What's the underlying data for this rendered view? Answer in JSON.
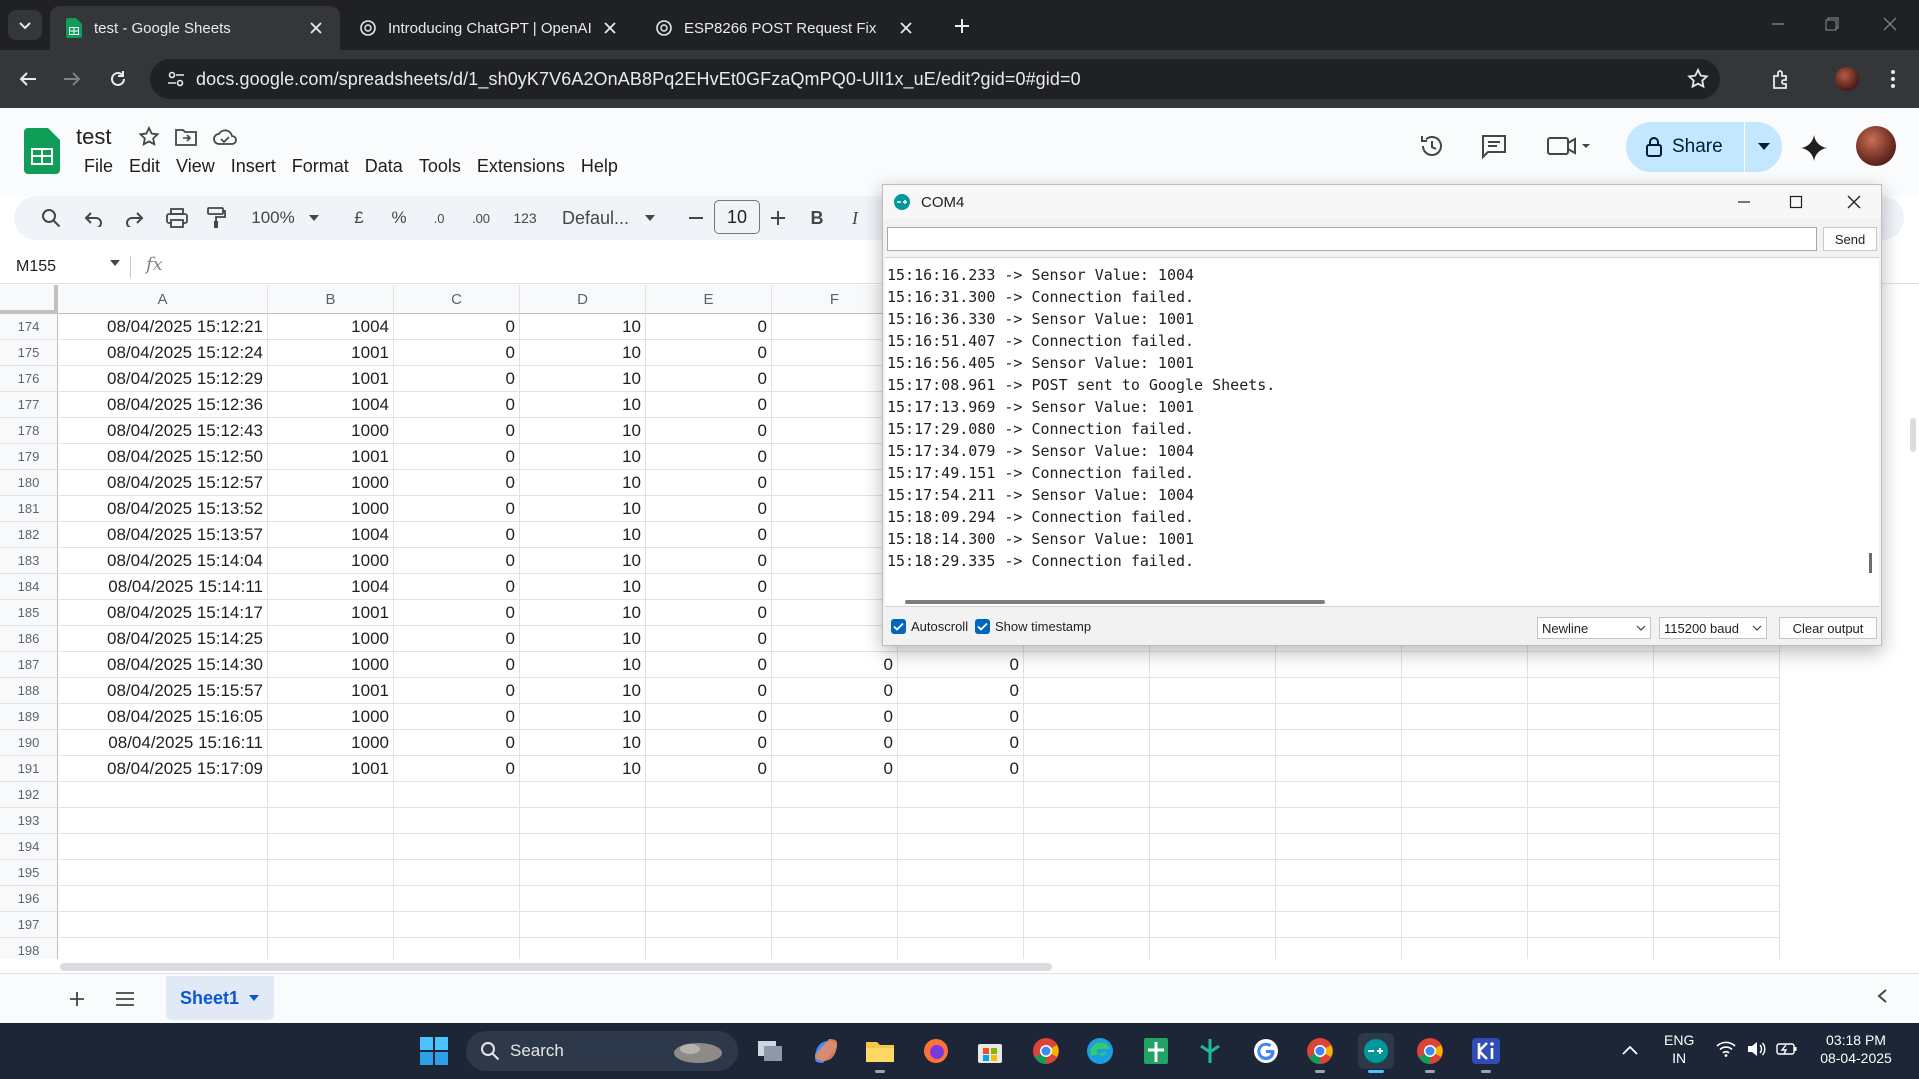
{
  "browser": {
    "tabs": [
      {
        "title": "test - Google Sheets",
        "icon": "sheets-icon"
      },
      {
        "title": "Introducing ChatGPT | OpenAI",
        "icon": "openai-icon"
      },
      {
        "title": "ESP8266 POST Request Fix",
        "icon": "openai-icon"
      }
    ],
    "url": "docs.google.com/spreadsheets/d/1_sh0yK7V6A2OnAB8Pq2EHvEt0GFzaQmPQ0-UlI1x_uE/edit?gid=0#gid=0"
  },
  "sheets": {
    "doc_title": "test",
    "menus": [
      "File",
      "Edit",
      "View",
      "Insert",
      "Format",
      "Data",
      "Tools",
      "Extensions",
      "Help"
    ],
    "share_label": "Share",
    "toolbar": {
      "zoom": "100%",
      "currency": "£",
      "percent": "%",
      "dec_decrease": ".0",
      "dec_increase": ".00",
      "format_123": "123",
      "font": "Defaul...",
      "font_size": "10",
      "bold": "B",
      "italic": "I"
    },
    "name_box": "M155",
    "fx": "fx",
    "columns": [
      "A",
      "B",
      "C",
      "D",
      "E",
      "F"
    ],
    "rows": [
      {
        "n": "174",
        "cells": [
          "08/04/2025 15:12:21",
          "1004",
          "0",
          "10",
          "0",
          "",
          ""
        ]
      },
      {
        "n": "175",
        "cells": [
          "08/04/2025 15:12:24",
          "1001",
          "0",
          "10",
          "0",
          "",
          ""
        ]
      },
      {
        "n": "176",
        "cells": [
          "08/04/2025 15:12:29",
          "1001",
          "0",
          "10",
          "0",
          "",
          ""
        ]
      },
      {
        "n": "177",
        "cells": [
          "08/04/2025 15:12:36",
          "1004",
          "0",
          "10",
          "0",
          "",
          ""
        ]
      },
      {
        "n": "178",
        "cells": [
          "08/04/2025 15:12:43",
          "1000",
          "0",
          "10",
          "0",
          "",
          ""
        ]
      },
      {
        "n": "179",
        "cells": [
          "08/04/2025 15:12:50",
          "1001",
          "0",
          "10",
          "0",
          "",
          ""
        ]
      },
      {
        "n": "180",
        "cells": [
          "08/04/2025 15:12:57",
          "1000",
          "0",
          "10",
          "0",
          "",
          ""
        ]
      },
      {
        "n": "181",
        "cells": [
          "08/04/2025 15:13:52",
          "1000",
          "0",
          "10",
          "0",
          "",
          ""
        ]
      },
      {
        "n": "182",
        "cells": [
          "08/04/2025 15:13:57",
          "1004",
          "0",
          "10",
          "0",
          "",
          ""
        ]
      },
      {
        "n": "183",
        "cells": [
          "08/04/2025 15:14:04",
          "1000",
          "0",
          "10",
          "0",
          "",
          ""
        ]
      },
      {
        "n": "184",
        "cells": [
          "08/04/2025 15:14:11",
          "1004",
          "0",
          "10",
          "0",
          "",
          ""
        ]
      },
      {
        "n": "185",
        "cells": [
          "08/04/2025 15:14:17",
          "1001",
          "0",
          "10",
          "0",
          "",
          ""
        ]
      },
      {
        "n": "186",
        "cells": [
          "08/04/2025 15:14:25",
          "1000",
          "0",
          "10",
          "0",
          "",
          ""
        ]
      },
      {
        "n": "187",
        "cells": [
          "08/04/2025 15:14:30",
          "1000",
          "0",
          "10",
          "0",
          "0",
          "0"
        ]
      },
      {
        "n": "188",
        "cells": [
          "08/04/2025 15:15:57",
          "1001",
          "0",
          "10",
          "0",
          "0",
          "0"
        ]
      },
      {
        "n": "189",
        "cells": [
          "08/04/2025 15:16:05",
          "1000",
          "0",
          "10",
          "0",
          "0",
          "0"
        ]
      },
      {
        "n": "190",
        "cells": [
          "08/04/2025 15:16:11",
          "1000",
          "0",
          "10",
          "0",
          "0",
          "0"
        ]
      },
      {
        "n": "191",
        "cells": [
          "08/04/2025 15:17:09",
          "1001",
          "0",
          "10",
          "0",
          "0",
          "0"
        ]
      },
      {
        "n": "192",
        "cells": [
          "",
          "",
          "",
          "",
          "",
          "",
          ""
        ]
      },
      {
        "n": "193",
        "cells": [
          "",
          "",
          "",
          "",
          "",
          "",
          ""
        ]
      },
      {
        "n": "194",
        "cells": [
          "",
          "",
          "",
          "",
          "",
          "",
          ""
        ]
      },
      {
        "n": "195",
        "cells": [
          "",
          "",
          "",
          "",
          "",
          "",
          ""
        ]
      },
      {
        "n": "196",
        "cells": [
          "",
          "",
          "",
          "",
          "",
          "",
          ""
        ]
      },
      {
        "n": "197",
        "cells": [
          "",
          "",
          "",
          "",
          "",
          "",
          ""
        ]
      },
      {
        "n": "198",
        "cells": [
          "",
          "",
          "",
          "",
          "",
          "",
          ""
        ]
      }
    ],
    "sheet_tab": "Sheet1"
  },
  "serial_monitor": {
    "title": "COM4",
    "send_label": "Send",
    "lines": [
      "15:16:16.233 -> Sensor Value: 1004",
      "15:16:31.300 -> Connection failed.",
      "15:16:36.330 -> Sensor Value: 1001",
      "15:16:51.407 -> Connection failed.",
      "15:16:56.405 -> Sensor Value: 1001",
      "15:17:08.961 -> POST sent to Google Sheets.",
      "15:17:13.969 -> Sensor Value: 1001",
      "15:17:29.080 -> Connection failed.",
      "15:17:34.079 -> Sensor Value: 1004",
      "15:17:49.151 -> Connection failed.",
      "15:17:54.211 -> Sensor Value: 1004",
      "15:18:09.294 -> Connection failed.",
      "15:18:14.300 -> Sensor Value: 1001",
      "15:18:29.335 -> Connection failed."
    ],
    "autoscroll_label": "Autoscroll",
    "autoscroll_checked": true,
    "timestamp_label": "Show timestamp",
    "timestamp_checked": true,
    "line_ending": "Newline",
    "baud": "115200 baud",
    "clear_label": "Clear output"
  },
  "taskbar": {
    "search_label": "Search",
    "lang_top": "ENG",
    "lang_bottom": "IN",
    "time": "03:18 PM",
    "date": "08-04-2025"
  }
}
